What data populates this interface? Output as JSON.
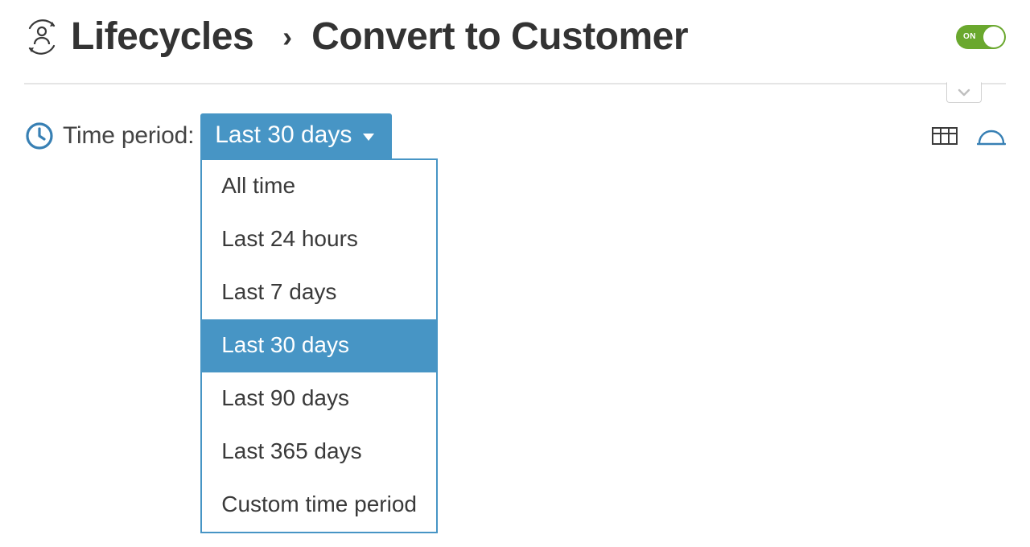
{
  "colors": {
    "accent_blue": "#4795c5",
    "accent_green": "#6aa82e",
    "icon_outline": "#3880b4",
    "text": "#3a3a3a",
    "border_gray": "#d0d0d0"
  },
  "header": {
    "breadcrumb": {
      "primary": "Lifecycles",
      "separator": "›",
      "secondary": "Convert to Customer"
    },
    "toggle": {
      "label": "ON",
      "state": true
    }
  },
  "controls": {
    "time_period": {
      "label": "Time period:",
      "selected": "Last 30 days",
      "options": [
        "All time",
        "Last 24 hours",
        "Last 7 days",
        "Last 30 days",
        "Last 90 days",
        "Last 365 days",
        "Custom time period"
      ]
    },
    "view_icons": {
      "table": "table-view",
      "gauge": "gauge-view"
    }
  }
}
